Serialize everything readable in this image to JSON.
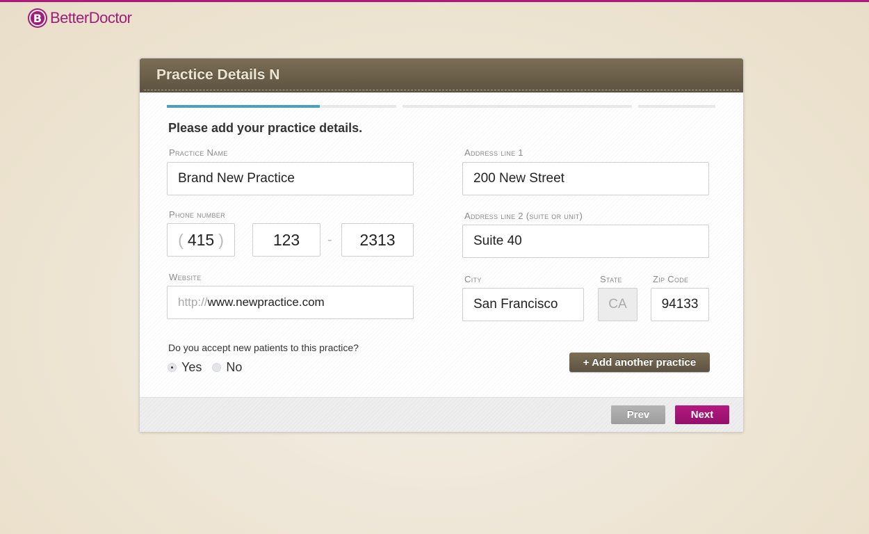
{
  "brand": {
    "name": "BetterDoctor",
    "mark": "B",
    "color": "#9b1f7a"
  },
  "card": {
    "title": "Practice Details N",
    "intro": "Please add your practice details."
  },
  "form": {
    "practice_name": {
      "label": "Practice Name",
      "value": "Brand New Practice"
    },
    "phone": {
      "label": "Phone number",
      "open_paren": "(",
      "close_paren": ")",
      "dash": "-",
      "area": "415",
      "prefix": "123",
      "line": "2313"
    },
    "website": {
      "label": "Website",
      "prefix": "http://",
      "value": "www.newpractice.com"
    },
    "address1": {
      "label": "Address line 1",
      "value": "200 New Street"
    },
    "address2": {
      "label": "Address line 2 (suite or unit)",
      "value": "Suite 40"
    },
    "city": {
      "label": "City",
      "value": "San Francisco"
    },
    "state": {
      "label": "State",
      "value": "CA"
    },
    "zip": {
      "label": "Zip Code",
      "value": "94133"
    },
    "new_patients": {
      "question": "Do you accept new patients to this practice?",
      "options": [
        "Yes",
        "No"
      ],
      "selected": "Yes"
    }
  },
  "buttons": {
    "add_practice": "+ Add another practice",
    "prev": "Prev",
    "next": "Next"
  },
  "colors": {
    "accent": "#b01a7e",
    "progress": "#4aa0bf",
    "header": "#6b5f4a"
  }
}
